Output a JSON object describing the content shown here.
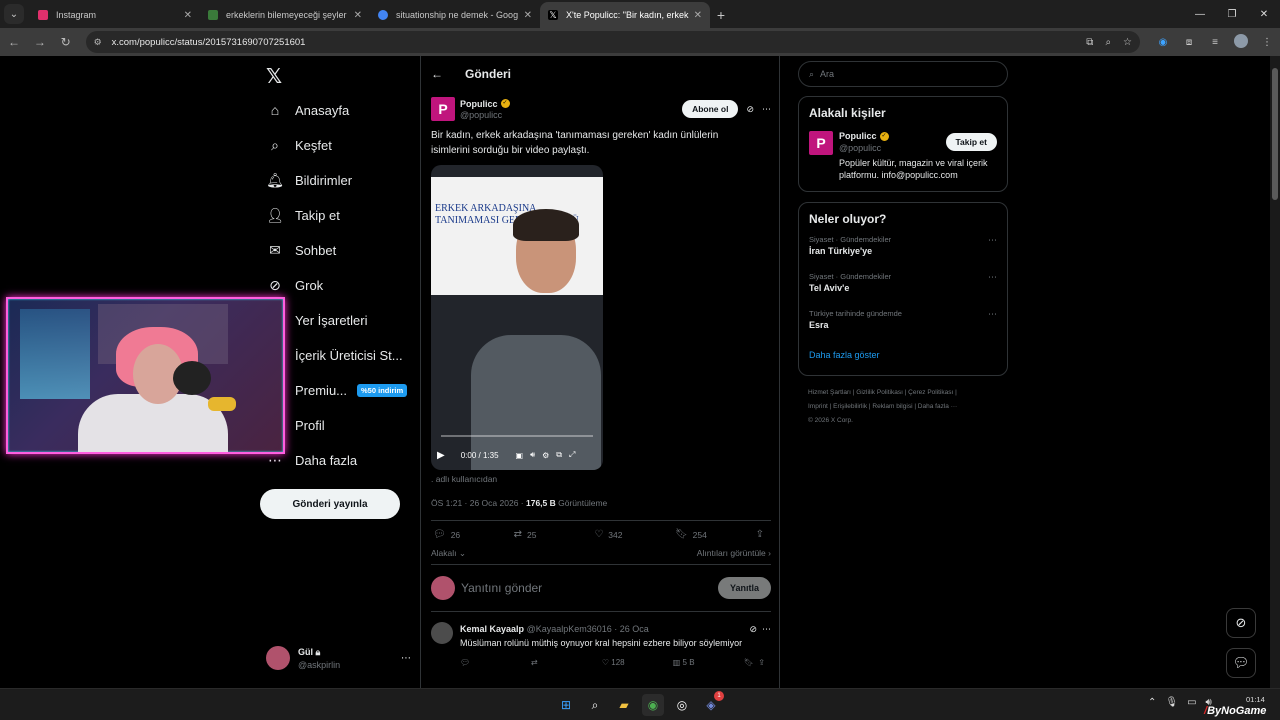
{
  "browser": {
    "tabs": [
      {
        "title": "Instagram",
        "color": "#e1306c",
        "active": false
      },
      {
        "title": "erkeklerin bilemeyeceği şeyler",
        "color": "#3a7a3a",
        "active": false
      },
      {
        "title": "situationship ne demek - Goog",
        "color": "#4285f4",
        "active": false
      },
      {
        "title": "X'te Populicc: \"Bir kadın, erkek a",
        "color": "#ffffff",
        "active": true
      }
    ],
    "url": "x.com/populicc/status/2015731690707251601"
  },
  "nav": {
    "items": [
      {
        "label": "Anasayfa",
        "icon": "home-icon"
      },
      {
        "label": "Keşfet",
        "icon": "search-icon"
      },
      {
        "label": "Bildirimler",
        "icon": "bell-icon"
      },
      {
        "label": "Takip et",
        "icon": "add-person-icon"
      },
      {
        "label": "Sohbet",
        "icon": "mail-icon"
      },
      {
        "label": "Grok",
        "icon": "grok-icon"
      },
      {
        "label": "Yer İşaretleri",
        "icon": "bookmark-icon"
      },
      {
        "label": "İçerik Üreticisi St...",
        "icon": "creator-icon"
      },
      {
        "label": "Premiu...",
        "icon": "premium-icon"
      },
      {
        "label": "Profil",
        "icon": "person-icon"
      },
      {
        "label": "Daha fazla",
        "icon": "more-icon"
      }
    ],
    "premium_badge": "%50 indirim",
    "post_button": "Gönderi yayınla",
    "account": {
      "name": "Gül",
      "handle": "@askpirlin"
    }
  },
  "tweet": {
    "header_title": "Gönderi",
    "author": {
      "name": "Populicc",
      "handle": "@populicc",
      "logo": "P"
    },
    "subscribe_label": "Abone ol",
    "text": "Bir kadın, erkek arkadaşına 'tanımaması gereken' kadın ünlülerin isimlerini sorduğu bir video paylaştı.",
    "video": {
      "screen_text": "ERKEK ARKADAŞINA TANIMAMASI GEREKEN ÜNLÜ",
      "time": "0:00 / 1:35"
    },
    "attribution": ". adlı kullanıcıdan",
    "meta": {
      "time": "ÖS 1:21 · 26 Oca 2026 · ",
      "views": "176,5 B",
      "views_label": " Görüntüleme"
    },
    "stats": {
      "replies": "26",
      "reposts": "25",
      "likes": "342",
      "bookmarks": "254"
    },
    "relevant_label": "Alakalı",
    "quotes_label": "Alıntıları görüntüle",
    "reply_placeholder": "Yanıtını gönder",
    "reply_button": "Yanıtla"
  },
  "comment": {
    "name": "Kemal Kayaalp",
    "handle": "@KayaalpKem36016",
    "date": "· 26 Oca",
    "text": "Müslüman rolünü müthiş oynuyor kral hepsini ezbere biliyor söylemiyor",
    "likes": "128",
    "views": "5 B"
  },
  "right": {
    "search_placeholder": "Ara",
    "related_title": "Alakalı kişiler",
    "related": {
      "name": "Populicc",
      "handle": "@populicc",
      "bio": "Popüler kültür, magazin ve viral içerik platformu. info@populicc.com",
      "follow": "Takip et"
    },
    "trends_title": "Neler oluyor?",
    "trends": [
      {
        "category": "Siyaset · Gündemdekiler",
        "title": "İran Türkiye'ye"
      },
      {
        "category": "Siyaset · Gündemdekiler",
        "title": "Tel Aviv'e"
      },
      {
        "category": "Türkiye tarihinde gündemde",
        "title": "Esra"
      }
    ],
    "show_more": "Daha fazla göster",
    "footer_lines": [
      "Hizmet Şartları  |  Gizlilik Politikası  |  Çerez Politikası  |",
      "Imprint  |  Erişilebilirlik  |  Reklam bilgisi  |  Daha fazla ···",
      "© 2026 X Corp."
    ]
  },
  "taskbar": {
    "time": "01:14",
    "discord_badge": "1",
    "watermark": "ByNoGame"
  },
  "colors": {
    "accent": "#1d9bf0",
    "brand": "#c0157d",
    "verified": "#e8b010"
  }
}
